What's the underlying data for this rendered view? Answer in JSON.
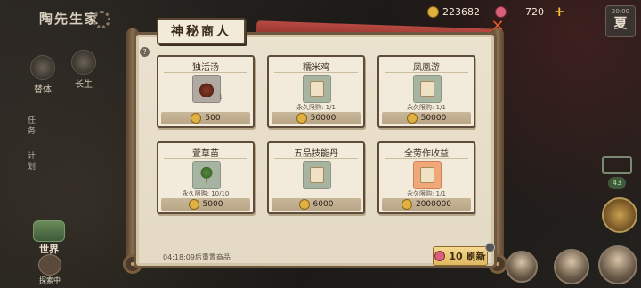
{
  "hud": {
    "game_title": "陶先生家",
    "left_icons": [
      {
        "label": "替体",
        "icon": "mushroom-icon"
      },
      {
        "label": "长生",
        "icon": "cauldron-icon"
      }
    ],
    "tasks_label": "任务",
    "plan_label": "计划",
    "world_label": "世界",
    "exploring_label": "探索中",
    "coins": "223682",
    "gems": "720",
    "season_time": "20:00",
    "season": "夏",
    "right_widget_value": "43"
  },
  "shop": {
    "title": "神秘商人",
    "limit_label": "永久限购:",
    "items": [
      {
        "name": "独活汤",
        "icon": "soup-pot-icon",
        "qty": "1",
        "limit": "",
        "price": "500",
        "frame": "grey",
        "art": "pot"
      },
      {
        "name": "糯米鸡",
        "icon": "recipe-scroll-icon",
        "qty": "",
        "limit": "1/1",
        "price": "50000",
        "frame": "green",
        "art": "scroll"
      },
      {
        "name": "凤凰游",
        "icon": "recipe-scroll-icon",
        "qty": "",
        "limit": "1/1",
        "price": "50000",
        "frame": "green",
        "art": "scroll"
      },
      {
        "name": "萱草苗",
        "icon": "sapling-icon",
        "qty": "",
        "limit": "10/10",
        "price": "5000",
        "frame": "green",
        "art": "tree"
      },
      {
        "name": "五品技能丹",
        "icon": "pill-scroll-icon",
        "qty": "",
        "limit": "",
        "price": "6000",
        "frame": "green",
        "art": "scroll"
      },
      {
        "name": "全劳作收益",
        "icon": "bonus-scroll-icon",
        "qty": "",
        "limit": "1/1",
        "price": "2000000",
        "frame": "orange",
        "art": "scroll"
      }
    ],
    "restock_text": "04:18:09后重置商品",
    "refresh_cost": "10",
    "refresh_label": "刷新"
  }
}
